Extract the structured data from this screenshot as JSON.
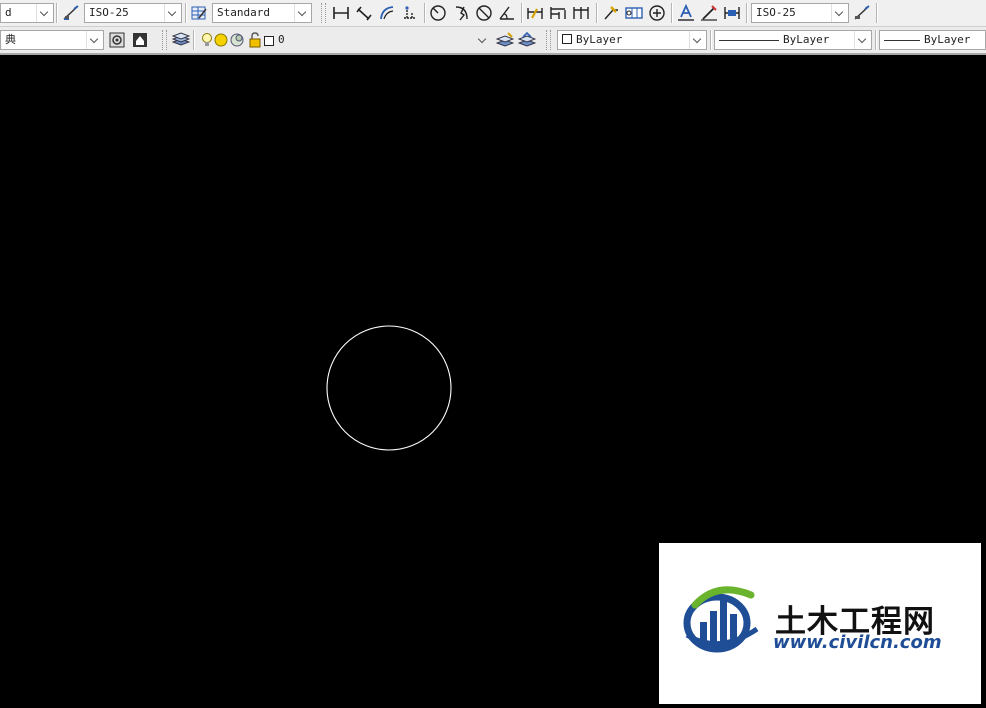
{
  "toolbar_row1": {
    "style_partial": "d",
    "dim_style": "ISO-25",
    "table_style": "Standard",
    "mleader_style": "ISO-25"
  },
  "toolbar_row2": {
    "workspace_partial": "典",
    "layer_name": "0",
    "color": "ByLayer",
    "linetype": "ByLayer",
    "lineweight": "ByLayer"
  },
  "drawing": {
    "shape": "circle",
    "stroke_color": "#ffffff",
    "background": "#000000"
  },
  "watermark": {
    "name": "土木工程网",
    "url": "www.civilcn.com"
  },
  "colors": {
    "toolbar_bg": "#f0f0f0",
    "logo_blue": "#1f4e96",
    "logo_green": "#6ab42d"
  }
}
